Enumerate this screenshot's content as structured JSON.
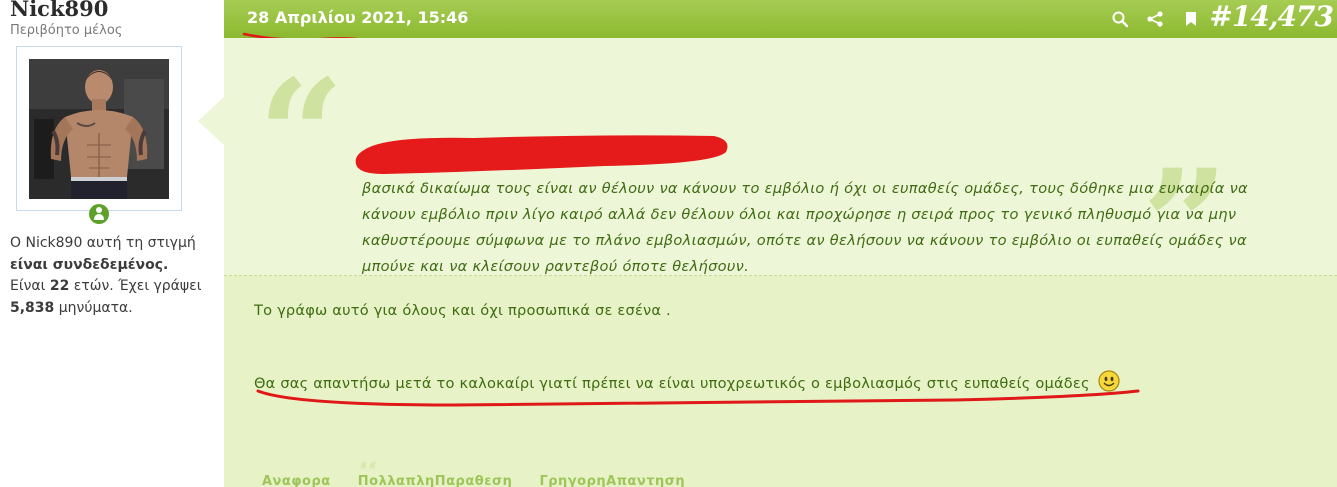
{
  "user": {
    "username": "Nick890",
    "title": "Περιβόητο μέλος",
    "status_prefix": "Ο Nick890 αυτή τη στιγμή",
    "status_bold": "είναι συνδεδεμένος.",
    "age_prefix": "Είναι",
    "age": "22",
    "age_suffix": "ετών.",
    "posts_prefix": "Έχει γράψει",
    "post_count": "5,838",
    "posts_suffix": "μηνύματα."
  },
  "post": {
    "date": "28 Απριλίου 2021, 15:46",
    "number": "#14,473",
    "header_icons": [
      "search-icon",
      "share-icon",
      "bookmark-icon"
    ],
    "quote_text": "βασικά δικαίωμα τους είναι αν θέλουν να κάνουν το εμβόλιο ή όχι οι ευπαθείς ομάδες, τους δόθηκε μια ευκαιρία να κάνουν εμβόλιο πριν λίγο καιρό αλλά δεν θέλουν όλοι και προχώρησε η σειρά προς το γενικό πληθυσμό για να μην καθυστέρουμε σύμφωνα με το πλάνο εμβολιασμών, οπότε αν θελήσουν να κάνουν το εμβόλιο οι ευπαθείς ομάδες να μπούνε και να κλείσουν ραντεβού όποτε θελήσουν.",
    "message_line1": "Το γράφω αυτό για όλους και όχι προσωπικά σε εσένα .",
    "message_line2": "Θα σας απαντήσω μετά το καλοκαίρι γιατί πρέπει να είναι υποχρεωτικός ο εμβολιασμός στις ευπαθείς ομάδες",
    "actions": [
      "Αναφορα",
      "ΠολλαπληΠαραθεση",
      "ΓρηγορηΑπαντηση"
    ]
  },
  "colors": {
    "header_green": "#8cb92f",
    "text_green": "#3f6b12",
    "quote_bg": "#eef6d8",
    "annotation_red": "#e01818"
  }
}
